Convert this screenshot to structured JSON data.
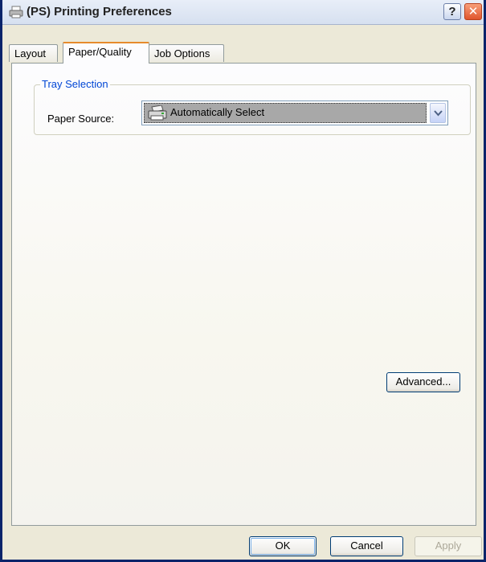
{
  "window": {
    "title": "(PS) Printing Preferences",
    "help_label": "?",
    "close_label": "✕"
  },
  "tabs": [
    {
      "label": "Layout",
      "active": false
    },
    {
      "label": "Paper/Quality",
      "active": true
    },
    {
      "label": "Job Options",
      "active": false
    }
  ],
  "tray_selection": {
    "legend": "Tray Selection",
    "paper_source_label": "Paper Source:",
    "paper_source_value": "Automatically Select"
  },
  "buttons": {
    "advanced": "Advanced...",
    "ok": "OK",
    "cancel": "Cancel",
    "apply": "Apply"
  },
  "icons": {
    "title": "printer-icon",
    "combo": "printer-icon",
    "dropdown": "chevron-down-icon"
  },
  "colors": {
    "legend": "#0046d5",
    "active_tab_accent": "#e68b2c",
    "close_button": "#e0552d"
  }
}
